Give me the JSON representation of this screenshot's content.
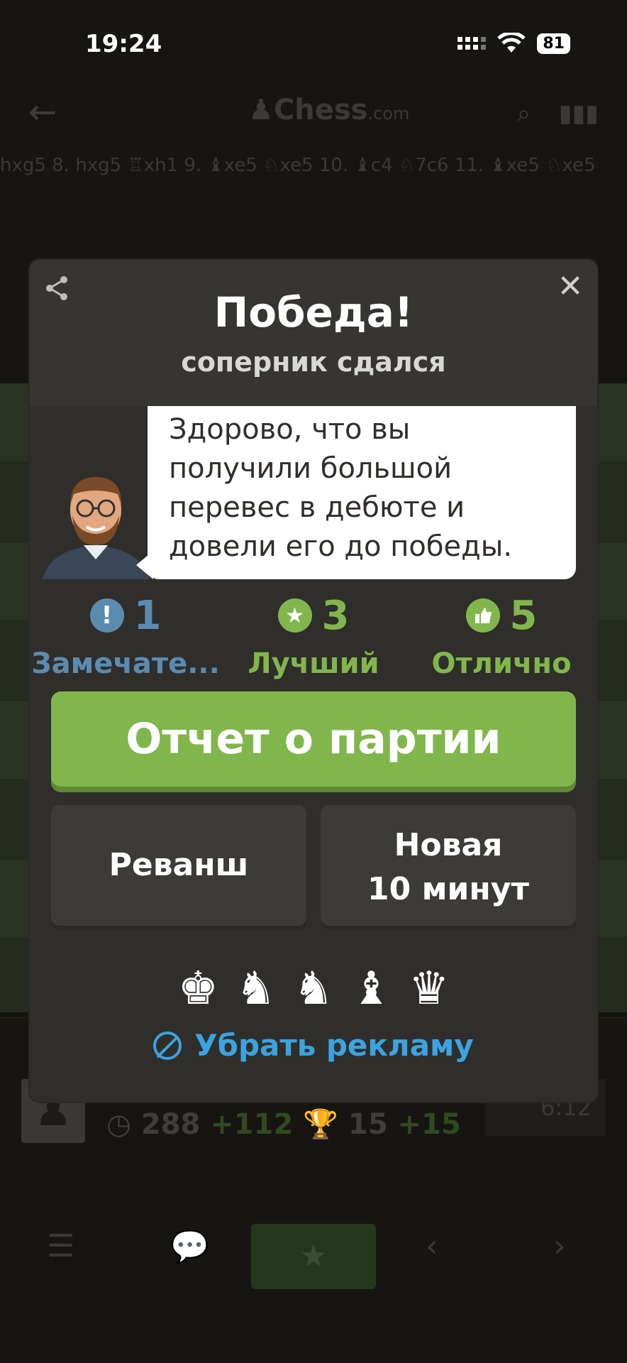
{
  "status_bar": {
    "time": "19:24",
    "battery": "81"
  },
  "top_bar": {
    "logo": "Chess",
    "logo_suffix": ".com"
  },
  "moves": "hxg5 8. hxg5 ♖xh1 9. ♝xe5 ♘xe5 10. ♝c4 ♘7c6 11. ♝xe5 ♘xe5",
  "player_bottom": {
    "rating": "288",
    "rating_change": "+112",
    "puzzle": "15",
    "puzzle_change": "+15",
    "clock": "6:12"
  },
  "modal": {
    "title": "Победа!",
    "subtitle": "соперник сдался",
    "coach_message": "Здорово, что вы получили большой перевес в дебюте и довели его до победы.",
    "stats": [
      {
        "count": "1",
        "label": "Замечате...",
        "color": "#5c8bb0",
        "icon": "exclamation-icon"
      },
      {
        "count": "3",
        "label": "Лучший",
        "color": "#81b64c",
        "icon": "star-icon"
      },
      {
        "count": "5",
        "label": "Отлично",
        "color": "#81b64c",
        "icon": "thumbs-up-icon"
      }
    ],
    "report_button": "Отчет о партии",
    "rematch_button": "Реванш",
    "new_game_line1": "Новая",
    "new_game_line2": "10 минут",
    "pieces": [
      "♚",
      "♞",
      "♞",
      "♝",
      "♛"
    ],
    "remove_ads": "Убрать рекламу"
  },
  "colors": {
    "accent_green": "#81b64c",
    "link_blue": "#3ba3e0",
    "modal_bg": "#302e2b"
  }
}
